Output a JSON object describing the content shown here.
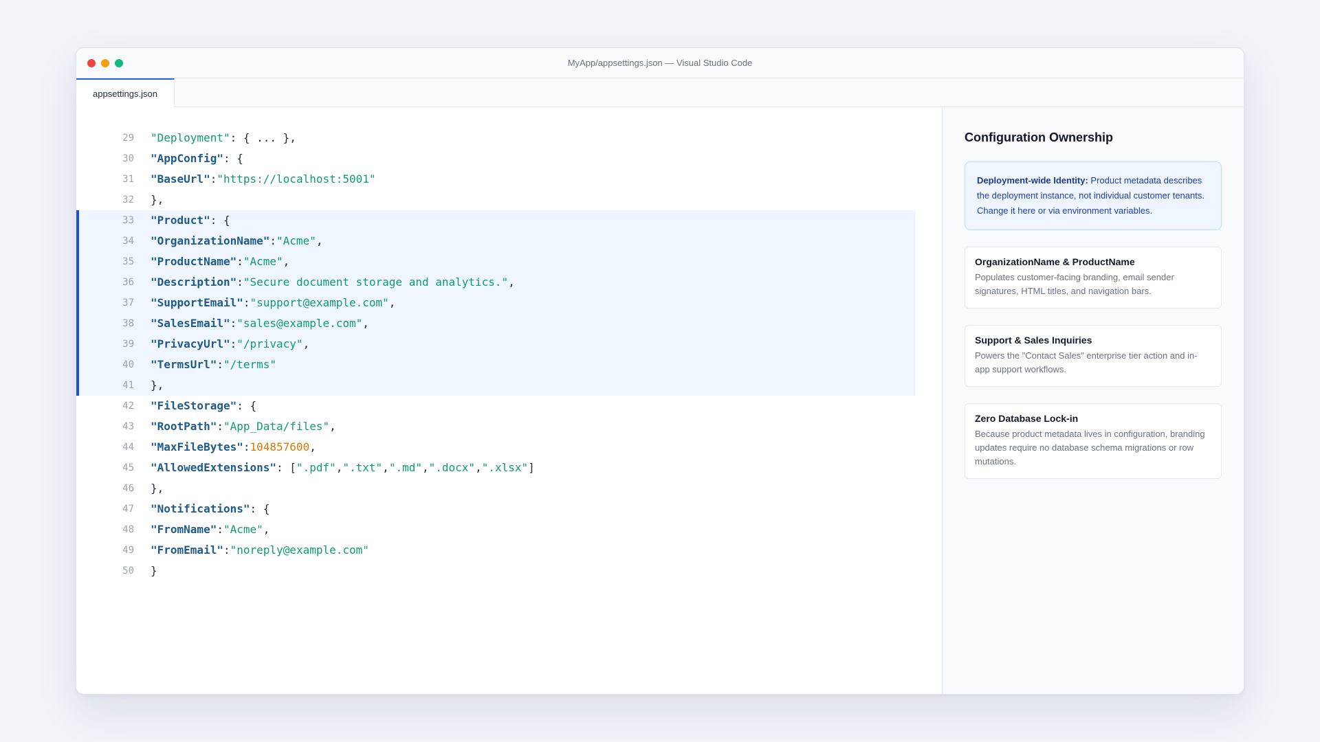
{
  "window": {
    "title": "MyApp/appsettings.json — Visual Studio Code"
  },
  "tabs": [
    {
      "label": "appsettings.json",
      "active": true
    }
  ],
  "code_lines": [
    {
      "num": "29",
      "tokens": [
        {
          "t": "s",
          "v": "\"Deployment\""
        },
        {
          "t": "p",
          "v": ": { ... },"
        }
      ]
    },
    {
      "num": "30",
      "tokens": [
        {
          "t": "k",
          "v": "\"AppConfig\""
        },
        {
          "t": "p",
          "v": ": {"
        }
      ]
    },
    {
      "num": "31",
      "tokens": [
        {
          "t": "k",
          "v": "\"BaseUrl\""
        },
        {
          "t": "p",
          "v": ":"
        },
        {
          "t": "s",
          "v": "\"https://localhost:5001\""
        }
      ]
    },
    {
      "num": "32",
      "tokens": [
        {
          "t": "p",
          "v": "},"
        }
      ]
    },
    {
      "num": "33",
      "hl": true,
      "tokens": [
        {
          "t": "k",
          "v": "\"Product\""
        },
        {
          "t": "p",
          "v": ": {"
        }
      ]
    },
    {
      "num": "34",
      "hl": true,
      "tokens": [
        {
          "t": "k",
          "v": "\"OrganizationName\""
        },
        {
          "t": "p",
          "v": ":"
        },
        {
          "t": "s",
          "v": "\"Acme\""
        },
        {
          "t": "p",
          "v": ","
        }
      ]
    },
    {
      "num": "35",
      "hl": true,
      "tokens": [
        {
          "t": "k",
          "v": "\"ProductName\""
        },
        {
          "t": "p",
          "v": ":"
        },
        {
          "t": "s",
          "v": "\"Acme\""
        },
        {
          "t": "p",
          "v": ","
        }
      ]
    },
    {
      "num": "36",
      "hl": true,
      "tokens": [
        {
          "t": "k",
          "v": "\"Description\""
        },
        {
          "t": "p",
          "v": ":"
        },
        {
          "t": "s",
          "v": "\"Secure document storage and analytics.\""
        },
        {
          "t": "p",
          "v": ","
        }
      ]
    },
    {
      "num": "37",
      "hl": true,
      "tokens": [
        {
          "t": "k",
          "v": "\"SupportEmail\""
        },
        {
          "t": "p",
          "v": ":"
        },
        {
          "t": "s",
          "v": "\"support@example.com\""
        },
        {
          "t": "p",
          "v": ","
        }
      ]
    },
    {
      "num": "38",
      "hl": true,
      "tokens": [
        {
          "t": "k",
          "v": "\"SalesEmail\""
        },
        {
          "t": "p",
          "v": ":"
        },
        {
          "t": "s",
          "v": "\"sales@example.com\""
        },
        {
          "t": "p",
          "v": ","
        }
      ]
    },
    {
      "num": "39",
      "hl": true,
      "tokens": [
        {
          "t": "k",
          "v": "\"PrivacyUrl\""
        },
        {
          "t": "p",
          "v": ":"
        },
        {
          "t": "s",
          "v": "\"/privacy\""
        },
        {
          "t": "p",
          "v": ","
        }
      ]
    },
    {
      "num": "40",
      "hl": true,
      "tokens": [
        {
          "t": "k",
          "v": "\"TermsUrl\""
        },
        {
          "t": "p",
          "v": ":"
        },
        {
          "t": "s",
          "v": "\"/terms\""
        }
      ]
    },
    {
      "num": "41",
      "hl": true,
      "tokens": [
        {
          "t": "p",
          "v": "},"
        }
      ]
    },
    {
      "num": "42",
      "tokens": [
        {
          "t": "k",
          "v": "\"FileStorage\""
        },
        {
          "t": "p",
          "v": ": {"
        }
      ]
    },
    {
      "num": "43",
      "tokens": [
        {
          "t": "k",
          "v": "\"RootPath\""
        },
        {
          "t": "p",
          "v": ":"
        },
        {
          "t": "s",
          "v": "\"App_Data/files\""
        },
        {
          "t": "p",
          "v": ","
        }
      ]
    },
    {
      "num": "44",
      "tokens": [
        {
          "t": "k",
          "v": "\"MaxFileBytes\""
        },
        {
          "t": "p",
          "v": ":"
        },
        {
          "t": "n",
          "v": "104857600"
        },
        {
          "t": "p",
          "v": ","
        }
      ]
    },
    {
      "num": "45",
      "tokens": [
        {
          "t": "k",
          "v": "\"AllowedExtensions\""
        },
        {
          "t": "p",
          "v": ": ["
        },
        {
          "t": "s",
          "v": "\".pdf\""
        },
        {
          "t": "p",
          "v": ","
        },
        {
          "t": "s",
          "v": "\".txt\""
        },
        {
          "t": "p",
          "v": ","
        },
        {
          "t": "s",
          "v": "\".md\""
        },
        {
          "t": "p",
          "v": ","
        },
        {
          "t": "s",
          "v": "\".docx\""
        },
        {
          "t": "p",
          "v": ","
        },
        {
          "t": "s",
          "v": "\".xlsx\""
        },
        {
          "t": "p",
          "v": "]"
        }
      ]
    },
    {
      "num": "46",
      "tokens": [
        {
          "t": "p",
          "v": "},"
        }
      ]
    },
    {
      "num": "47",
      "tokens": [
        {
          "t": "k",
          "v": "\"Notifications\""
        },
        {
          "t": "p",
          "v": ": {"
        }
      ]
    },
    {
      "num": "48",
      "tokens": [
        {
          "t": "k",
          "v": "\"FromName\""
        },
        {
          "t": "p",
          "v": ":"
        },
        {
          "t": "s",
          "v": "\"Acme\""
        },
        {
          "t": "p",
          "v": ","
        }
      ]
    },
    {
      "num": "49",
      "tokens": [
        {
          "t": "k",
          "v": "\"FromEmail\""
        },
        {
          "t": "p",
          "v": ":"
        },
        {
          "t": "s",
          "v": "\"noreply@example.com\""
        }
      ]
    },
    {
      "num": "50",
      "tokens": [
        {
          "t": "p",
          "v": "}"
        }
      ]
    }
  ],
  "sidebar": {
    "title": "Configuration Ownership",
    "callout": {
      "lead": "Deployment-wide Identity:",
      "text": " Product metadata describes the deployment instance, not individual customer tenants. Change it here or via environment variables."
    },
    "cards": [
      {
        "title": "OrganizationName & ProductName",
        "desc": "Populates customer-facing branding, email sender signatures, HTML titles, and navigation bars."
      },
      {
        "title": "Support & Sales Inquiries",
        "desc": "Powers the \"Contact Sales\" enterprise tier action and in-app support workflows."
      },
      {
        "title": "Zero Database Lock-in",
        "desc": "Because product metadata lives in configuration, branding updates require no database schema migrations or row mutations."
      }
    ]
  },
  "colors": {
    "accent": "#2563eb",
    "highlight_bg": "#eff6ff",
    "key": "#1e5a8c",
    "string": "#0f9b6e",
    "number": "#d97706"
  }
}
